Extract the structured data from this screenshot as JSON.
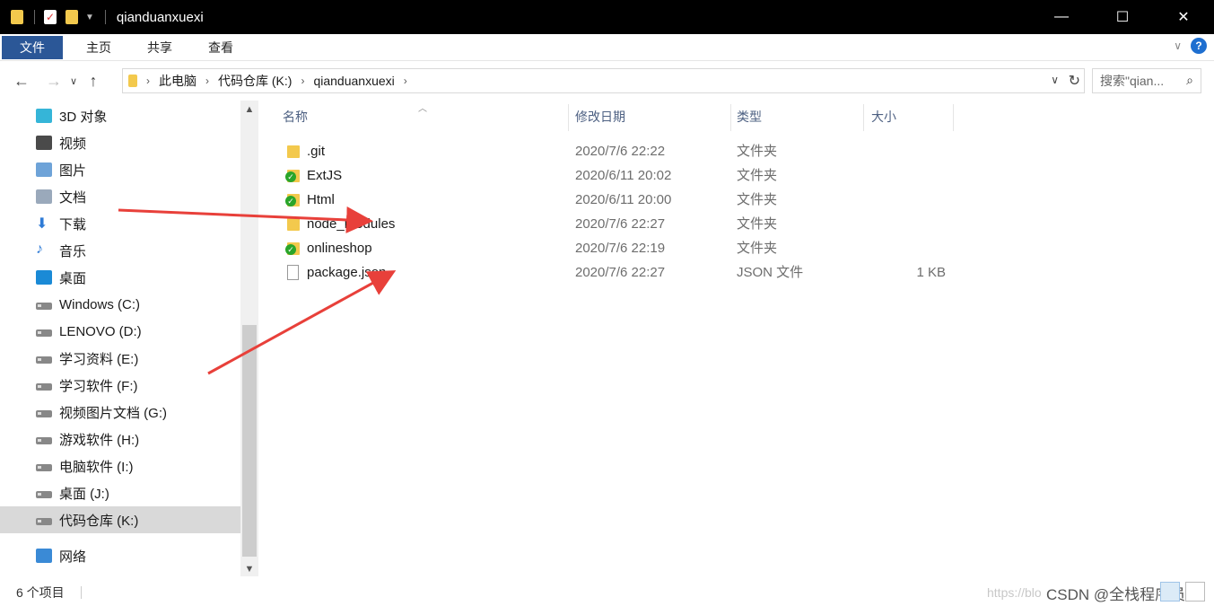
{
  "window": {
    "title": "qianduanxuexi",
    "controls": [
      "minimize-icon",
      "maximize-icon",
      "close-icon"
    ]
  },
  "ribbon": {
    "tabs": [
      "文件",
      "主页",
      "共享",
      "查看"
    ]
  },
  "address": {
    "crumbs": [
      "此电脑",
      "代码仓库 (K:)",
      "qianduanxuexi"
    ],
    "search_placeholder": "搜索\"qian..."
  },
  "nav": {
    "items": [
      {
        "label": "3D 对象",
        "icon": "3d-objects-icon"
      },
      {
        "label": "视频",
        "icon": "videos-icon"
      },
      {
        "label": "图片",
        "icon": "pictures-icon"
      },
      {
        "label": "文档",
        "icon": "documents-icon"
      },
      {
        "label": "下载",
        "icon": "downloads-icon"
      },
      {
        "label": "音乐",
        "icon": "music-icon"
      },
      {
        "label": "桌面",
        "icon": "desktop-icon"
      },
      {
        "label": "Windows (C:)",
        "icon": "drive-icon"
      },
      {
        "label": "LENOVO (D:)",
        "icon": "drive-icon"
      },
      {
        "label": "学习资料 (E:)",
        "icon": "drive-icon"
      },
      {
        "label": "学习软件 (F:)",
        "icon": "drive-icon"
      },
      {
        "label": "视频图片文档 (G:)",
        "icon": "drive-icon"
      },
      {
        "label": "游戏软件 (H:)",
        "icon": "drive-icon"
      },
      {
        "label": "电脑软件 (I:)",
        "icon": "drive-icon"
      },
      {
        "label": "桌面 (J:)",
        "icon": "drive-icon"
      },
      {
        "label": "代码仓库 (K:)",
        "icon": "drive-icon",
        "selected": true
      },
      {
        "label": "网络",
        "icon": "network-icon"
      }
    ]
  },
  "files": {
    "columns": [
      "名称",
      "修改日期",
      "类型",
      "大小"
    ],
    "rows": [
      {
        "name": ".git",
        "date": "2020/7/6 22:22",
        "type": "文件夹",
        "size": "",
        "icon": "folder-icon"
      },
      {
        "name": "ExtJS",
        "date": "2020/6/11 20:02",
        "type": "文件夹",
        "size": "",
        "icon": "synced-folder-icon"
      },
      {
        "name": "Html",
        "date": "2020/6/11 20:00",
        "type": "文件夹",
        "size": "",
        "icon": "synced-folder-icon"
      },
      {
        "name": "node_modules",
        "date": "2020/7/6 22:27",
        "type": "文件夹",
        "size": "",
        "icon": "folder-icon"
      },
      {
        "name": "onlineshop",
        "date": "2020/7/6 22:19",
        "type": "文件夹",
        "size": "",
        "icon": "synced-folder-icon"
      },
      {
        "name": "package.json",
        "date": "2020/7/6 22:27",
        "type": "JSON 文件",
        "size": "1 KB",
        "icon": "file-icon"
      }
    ]
  },
  "status": {
    "count": "6 个项目",
    "watermark": "https://blo",
    "credit": "CSDN @全栈程序员"
  },
  "colors": {
    "accent": "#2b5797",
    "arrow": "#e8403a"
  }
}
